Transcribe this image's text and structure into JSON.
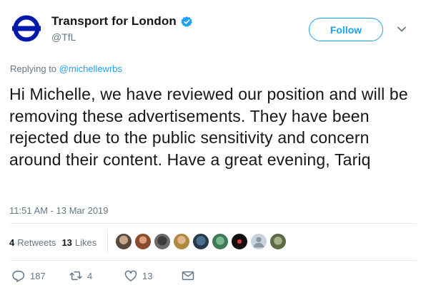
{
  "header": {
    "display_name": "Transport for London",
    "handle": "@TfL",
    "follow_label": "Follow",
    "verified": true
  },
  "reply": {
    "prefix": "Replying to",
    "target": "@michellewrbs"
  },
  "tweet": {
    "text": "Hi Michelle, we have reviewed our position and will be removing these advertisements. They have been rejected due to the public sensitivity and concern around their content. Have a great evening, Tariq",
    "timestamp": "11:51 AM - 13 Mar 2019"
  },
  "stats": {
    "retweets_count": "4",
    "retweets_label": "Retweets",
    "likes_count": "13",
    "likes_label": "Likes",
    "liker_avatar_count": 9
  },
  "actions": {
    "reply_count": "187",
    "retweet_count": "4",
    "like_count": "13"
  },
  "colors": {
    "accent": "#1da1f2",
    "secondary_text": "#657786",
    "roundel_red": "#dc241f",
    "roundel_blue": "#0019a8"
  }
}
